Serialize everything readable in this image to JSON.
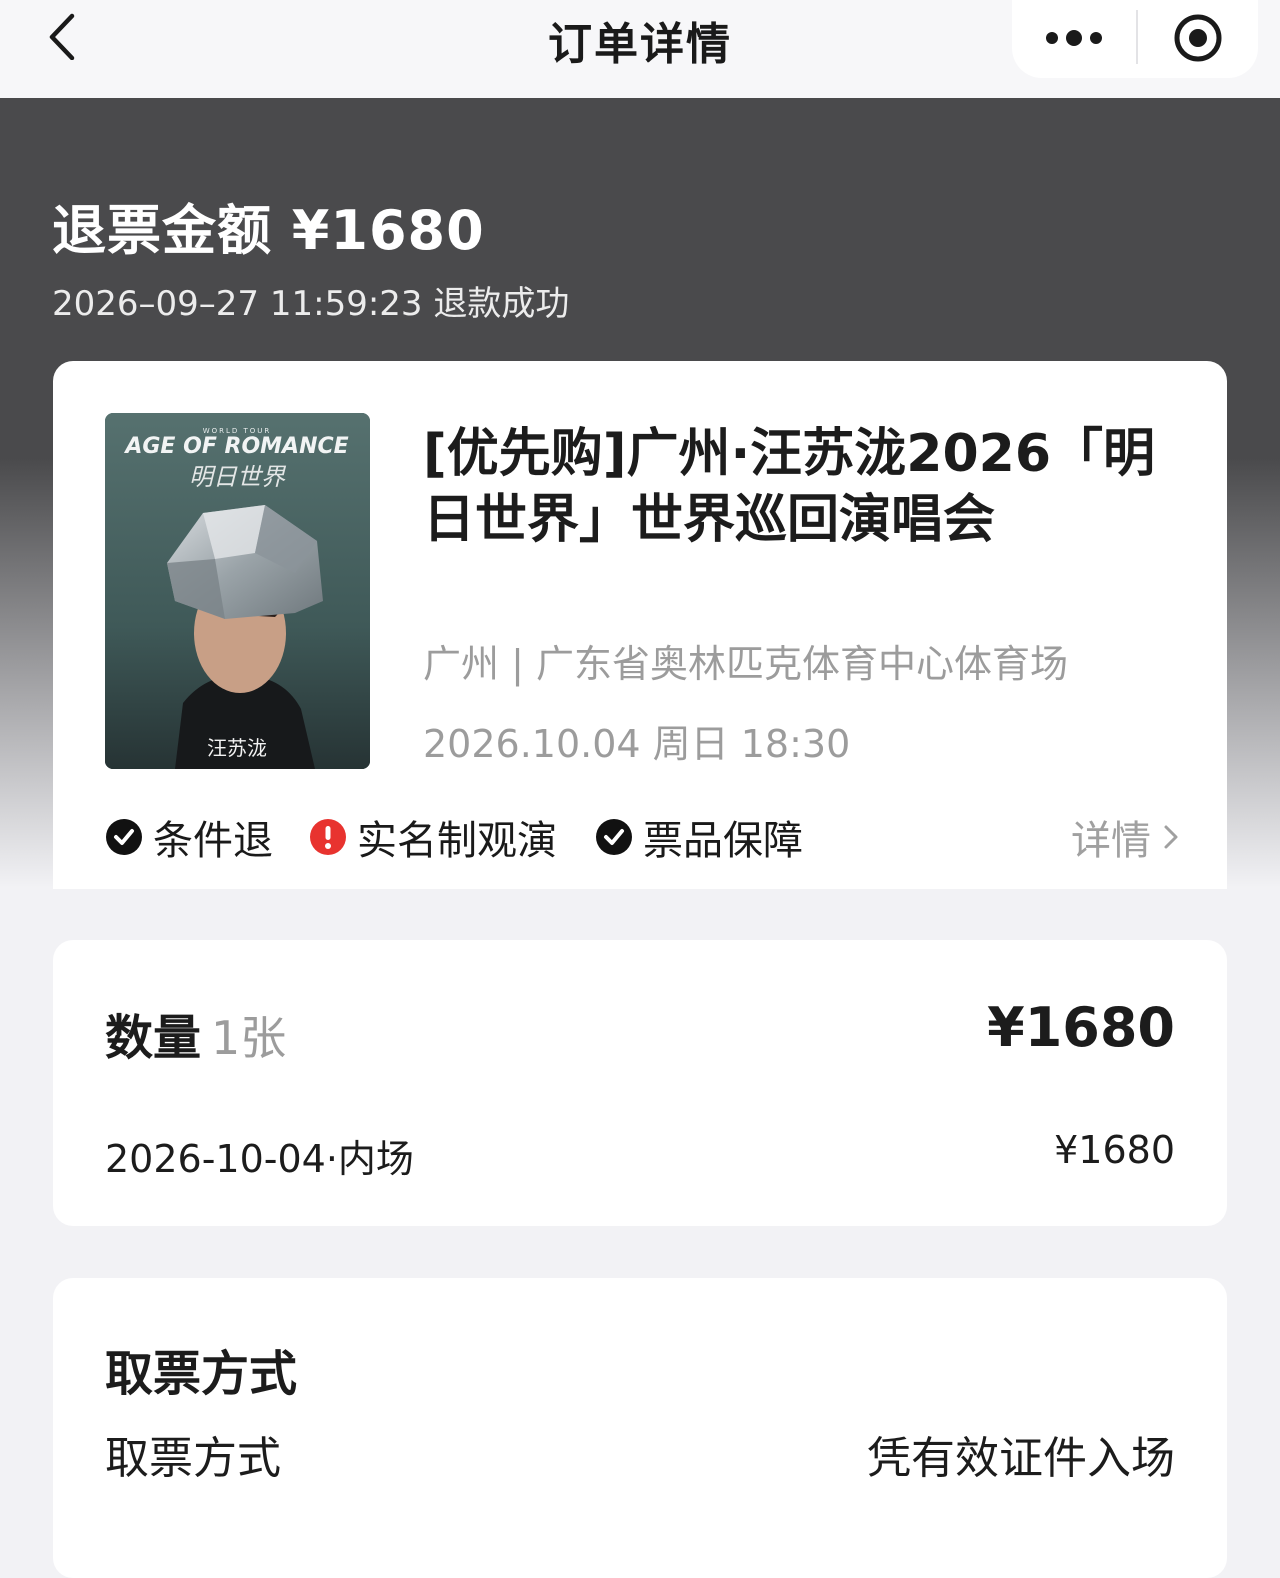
{
  "header": {
    "title": "订单详情",
    "back_icon": "chevron-left-icon",
    "more_icon": "more-dots-icon",
    "close_icon": "target-close-icon"
  },
  "refund": {
    "amount_text": "退票金额 ¥1680",
    "status_text": "2026–09–27 11:59:23 退款成功"
  },
  "show": {
    "poster": {
      "top_caption": "WORLD TOUR",
      "title": "AGE OF ROMANCE",
      "subtitle": "明日世界",
      "artist": "汪苏泷"
    },
    "title": "[优先购]广州·汪苏泷2026「明日世界」世界巡回演唱会",
    "venue": "广州 | 广东省奥林匹克体育中心体育场",
    "time": "2026.10.04 周日 18:30",
    "tags": [
      {
        "label": "条件退",
        "icon": "check-circle-icon"
      },
      {
        "label": "实名制观演",
        "icon": "alert-circle-icon"
      },
      {
        "label": "票品保障",
        "icon": "check-circle-icon"
      }
    ],
    "detail_label": "详情"
  },
  "quantity": {
    "label": "数量",
    "value": "1张",
    "total": "¥1680",
    "seat_desc": "2026-10-04·内场",
    "seat_price": "¥1680"
  },
  "pickup": {
    "heading": "取票方式",
    "label": "取票方式",
    "value": "凭有效证件入场"
  },
  "colors": {
    "hero_dark": "#4a4a4c",
    "alert_red": "#e8332f",
    "muted_text": "#9c9c9c",
    "page_bg": "#f2f2f5"
  }
}
